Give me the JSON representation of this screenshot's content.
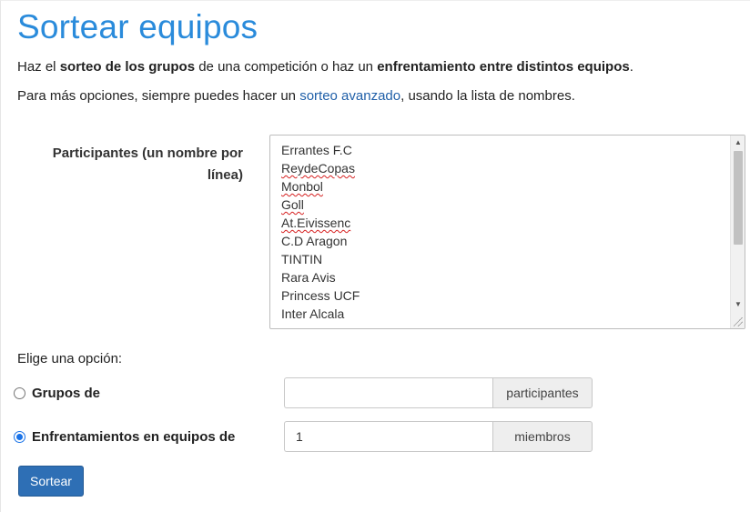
{
  "header": {
    "title": "Sortear equipos"
  },
  "intro": {
    "p1_a": "Haz el ",
    "p1_b": "sorteo de los grupos",
    "p1_c": " de una competición o haz un ",
    "p1_d": "enfrentamiento entre distintos equipos",
    "p1_e": ".",
    "p2_a": "Para más opciones, siempre puedes hacer un ",
    "p2_link": "sorteo avanzado",
    "p2_b": ", usando la lista de nombres."
  },
  "participants": {
    "label_line1": "Participantes (un nombre por",
    "label_line2": "línea)",
    "lines": [
      "Errantes F.C",
      "ReydeCopas",
      "Monbol",
      "Goll",
      "At.Eivissenc",
      "C.D Aragon",
      "TINTIN",
      "Rara Avis",
      "Princess UCF",
      "Inter Alcala"
    ]
  },
  "options": {
    "prompt": "Elige una opción:",
    "groups": {
      "label": "Grupos de",
      "value": "",
      "addon": "participantes",
      "checked": false
    },
    "teams": {
      "label": "Enfrentamientos en equipos de",
      "value": "1",
      "addon": "miembros",
      "checked": true
    }
  },
  "actions": {
    "submit_label": "Sortear"
  },
  "colors": {
    "title": "#2a8bdb",
    "link": "#1f5fa8",
    "button": "#2e6fb5",
    "radio_checked": "#1a73e8"
  }
}
